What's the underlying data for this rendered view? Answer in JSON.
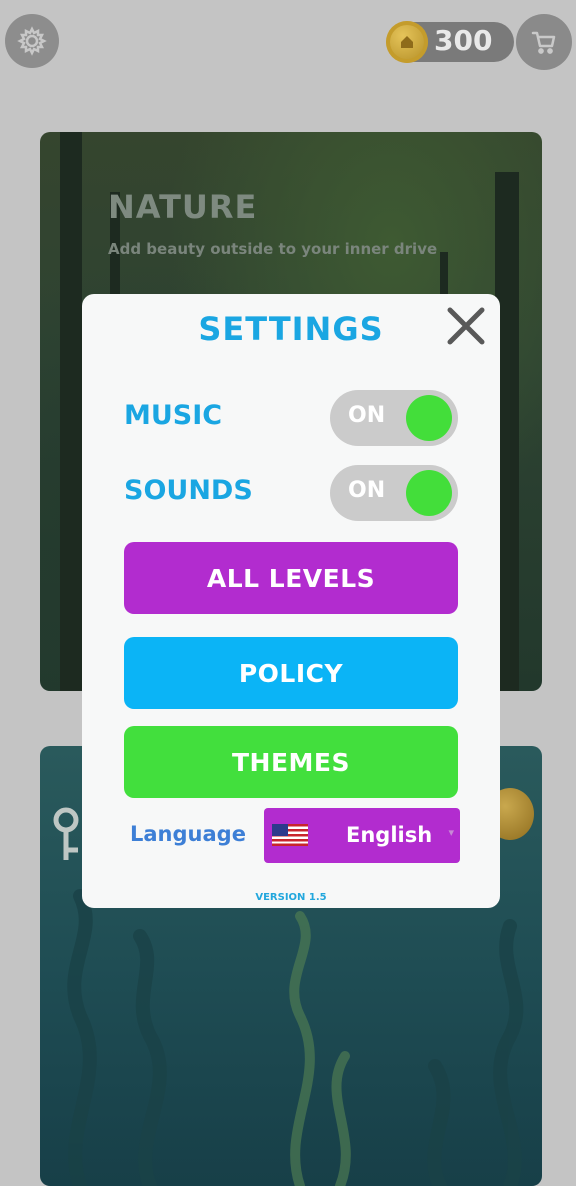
{
  "topbar": {
    "coins": "300",
    "settings_icon": "gear-icon",
    "cart_icon": "cart-icon"
  },
  "cards": [
    {
      "title": "NATURE",
      "subtitle": "Add beauty outside to your inner drive"
    }
  ],
  "settings": {
    "title": "SETTINGS",
    "close_icon": "close-icon",
    "music_label": "MUSIC",
    "music_state": "ON",
    "sounds_label": "SOUNDS",
    "sounds_state": "ON",
    "all_levels_label": "ALL LEVELS",
    "policy_label": "POLICY",
    "themes_label": "THEMES",
    "language_label": "Language",
    "language_value": "English",
    "version": "VERSION 1.5"
  },
  "colors": {
    "accent_blue": "#1aa6e2",
    "toggle_on": "#43de3a",
    "all_levels": "#b22ccf",
    "policy": "#0bb4f6",
    "themes": "#42df3d"
  }
}
